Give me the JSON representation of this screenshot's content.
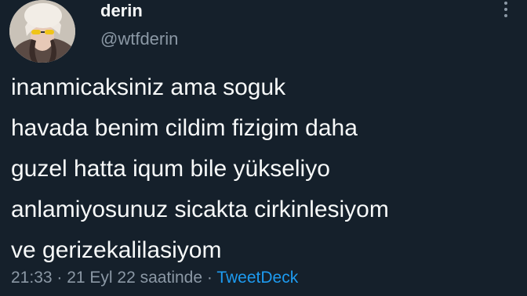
{
  "author": {
    "display_name": "derin",
    "handle": "@wtfderin"
  },
  "more_menu": {
    "icon": "more-vertical-icon"
  },
  "tweet": {
    "lines": [
      "inanmicaksiniz ama soguk",
      "havada benim cildim fizigim daha",
      "guzel hatta iqum bile yükseliyo",
      "anlamiyosunuz sicakta cirkinlesiyom",
      "ve gerizekalilasiyom"
    ]
  },
  "meta": {
    "time": "21:33",
    "sep1": " · ",
    "date": "21 Eyl 22 saatinde",
    "sep2": " · ",
    "source": "TweetDeck"
  },
  "colors": {
    "background": "#15202b",
    "primary_text": "#f7f9f9",
    "secondary_text": "#8b98a5",
    "link": "#1d9bf0"
  }
}
